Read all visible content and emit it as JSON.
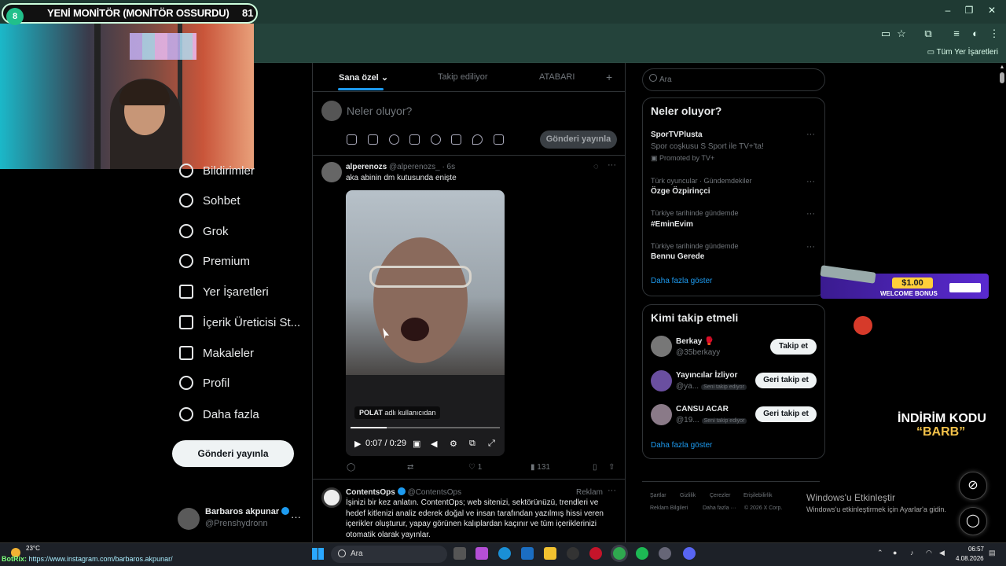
{
  "overlay": {
    "badge": "8",
    "title": "YENİ MONİTÖR (MONİTÖR OSSURDU)",
    "count": "81"
  },
  "browser": {
    "bookmarks_label": "Tüm Yer İşaretleri",
    "window_controls": [
      "–",
      "❐",
      "✕"
    ]
  },
  "nav": {
    "items": [
      {
        "label": "Bildirimler",
        "icon": "bell-icon"
      },
      {
        "label": "Sohbet",
        "icon": "chat-icon"
      },
      {
        "label": "Grok",
        "icon": "grok-icon"
      },
      {
        "label": "Premium",
        "icon": "premium-icon"
      },
      {
        "label": "Yer İşaretleri",
        "icon": "bookmark-icon"
      },
      {
        "label": "İçerik Üreticisi St...",
        "icon": "rocket-icon"
      },
      {
        "label": "Makaleler",
        "icon": "article-icon"
      },
      {
        "label": "Profil",
        "icon": "person-icon"
      },
      {
        "label": "Daha fazla",
        "icon": "more-circle-icon"
      }
    ],
    "post_button": "Gönderi yayınla",
    "account": {
      "name": "Barbaros akpunar",
      "handle": "@Prenshydronn",
      "more": "···"
    }
  },
  "tabs": {
    "for_you": "Sana özel",
    "following": "Takip ediliyor",
    "atabari": "ATABARI",
    "add": "+"
  },
  "compose": {
    "placeholder": "Neler oluyor?",
    "post_button": "Gönderi yayınla"
  },
  "tweet": {
    "name": "alperenozs",
    "handle": "@alperenozs_ · 6s",
    "text": "aka abinin dm kutusunda enişte",
    "video_tag_user": "POLAT",
    "video_tag_rest": " adlı kullanıcıdan",
    "video_time": "0:07 / 0:29",
    "video_progress": 0.24,
    "views": "131",
    "likes": "1"
  },
  "ad": {
    "name": "ContentsOps",
    "handle": "@ContentsOps",
    "label": "Reklam",
    "text": "İşinizi bir kez anlatın. ContentOps; web sitenizi, sektörünüzü, trendleri ve hedef kitlenizi analiz ederek doğal ve insan tarafından yazılmış hissi veren içerikler oluşturur, yapay görünen kalıplardan kaçınır ve tüm içeriklerinizi otomatik olarak yayınlar."
  },
  "search": {
    "placeholder": "Ara"
  },
  "trends": {
    "title": "Neler oluyor?",
    "items": [
      {
        "name": "SporTVPlusta",
        "sub": "Spor coşkusu S Sport ile TV+'ta!",
        "meta": "Promoted by TV+"
      },
      {
        "meta": "Türk oyuncular · Gündemdekiler",
        "name": "Özge Özpirinçci"
      },
      {
        "meta": "Türkiye tarihinde gündemde",
        "name": "#EminEvim"
      },
      {
        "meta": "Türkiye tarihinde gündemde",
        "name": "Bennu Gerede"
      }
    ],
    "show_more": "Daha fazla göster"
  },
  "who_to_follow": {
    "title": "Kimi takip etmeli",
    "items": [
      {
        "name": "Berkay 🥊",
        "handle": "@35berkayy",
        "chip": "",
        "button": "Takip et"
      },
      {
        "name": "Yayıncılar İzliyor",
        "handle": "@ya...",
        "chip": "Seni takip ediyor",
        "button": "Geri takip et"
      },
      {
        "name": "CANSU ACAR",
        "handle": "@19...",
        "chip": "Seni takip ediyor",
        "button": "Geri takip et"
      }
    ],
    "show_more": "Daha fazla göster"
  },
  "footer": {
    "links": [
      "Şartlar",
      "Gizlilik",
      "Çerezler",
      "Erişilebilirlik",
      "Reklam Bilgileri",
      "Daha fazla ···",
      "© 2026 X Corp."
    ]
  },
  "windows_activation": {
    "title": "Windows'u Etkinleştir",
    "sub": "Windows'u etkinleştirmek için Ayarlar'a gidin."
  },
  "promo": {
    "amount": "$1.00",
    "text": "WELCOME BONUS",
    "code_line1": "İNDİRİM KODU",
    "code_line2": "“BARB”"
  },
  "taskbar": {
    "weather": "23°C",
    "url_label": "BotRix:",
    "url": " https://www.instagram.com/barbaros.akpunar/",
    "search": "Ara",
    "time": "06:57",
    "date": "4.08.2026"
  },
  "colors": {
    "accent": "#1d9bf0",
    "chrome": "#24433b",
    "background": "#000000"
  }
}
